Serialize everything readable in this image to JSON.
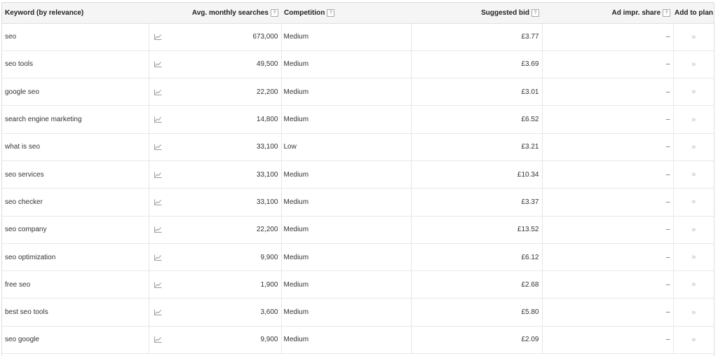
{
  "table": {
    "headers": {
      "keyword": "Keyword (by relevance)",
      "searches": "Avg. monthly searches",
      "competition": "Competition",
      "bid": "Suggested bid",
      "impr_share": "Ad impr. share",
      "add": "Add to plan"
    },
    "help_glyph": "?",
    "add_glyph": "»",
    "trend_icon": "line-chart-icon",
    "rows": [
      {
        "keyword": "seo",
        "searches": "673,000",
        "competition": "Medium",
        "bid": "£3.77",
        "impr_share": "–"
      },
      {
        "keyword": "seo tools",
        "searches": "49,500",
        "competition": "Medium",
        "bid": "£3.69",
        "impr_share": "–"
      },
      {
        "keyword": "google seo",
        "searches": "22,200",
        "competition": "Medium",
        "bid": "£3.01",
        "impr_share": "–"
      },
      {
        "keyword": "search engine marketing",
        "searches": "14,800",
        "competition": "Medium",
        "bid": "£6.52",
        "impr_share": "–"
      },
      {
        "keyword": "what is seo",
        "searches": "33,100",
        "competition": "Low",
        "bid": "£3.21",
        "impr_share": "–"
      },
      {
        "keyword": "seo services",
        "searches": "33,100",
        "competition": "Medium",
        "bid": "£10.34",
        "impr_share": "–"
      },
      {
        "keyword": "seo checker",
        "searches": "33,100",
        "competition": "Medium",
        "bid": "£3.37",
        "impr_share": "–"
      },
      {
        "keyword": "seo company",
        "searches": "22,200",
        "competition": "Medium",
        "bid": "£13.52",
        "impr_share": "–"
      },
      {
        "keyword": "seo optimization",
        "searches": "9,900",
        "competition": "Medium",
        "bid": "£6.12",
        "impr_share": "–"
      },
      {
        "keyword": "free seo",
        "searches": "1,900",
        "competition": "Medium",
        "bid": "£2.68",
        "impr_share": "–"
      },
      {
        "keyword": "best seo tools",
        "searches": "3,600",
        "competition": "Medium",
        "bid": "£5.80",
        "impr_share": "–"
      },
      {
        "keyword": "seo google",
        "searches": "9,900",
        "competition": "Medium",
        "bid": "£2.09",
        "impr_share": "–"
      }
    ]
  }
}
